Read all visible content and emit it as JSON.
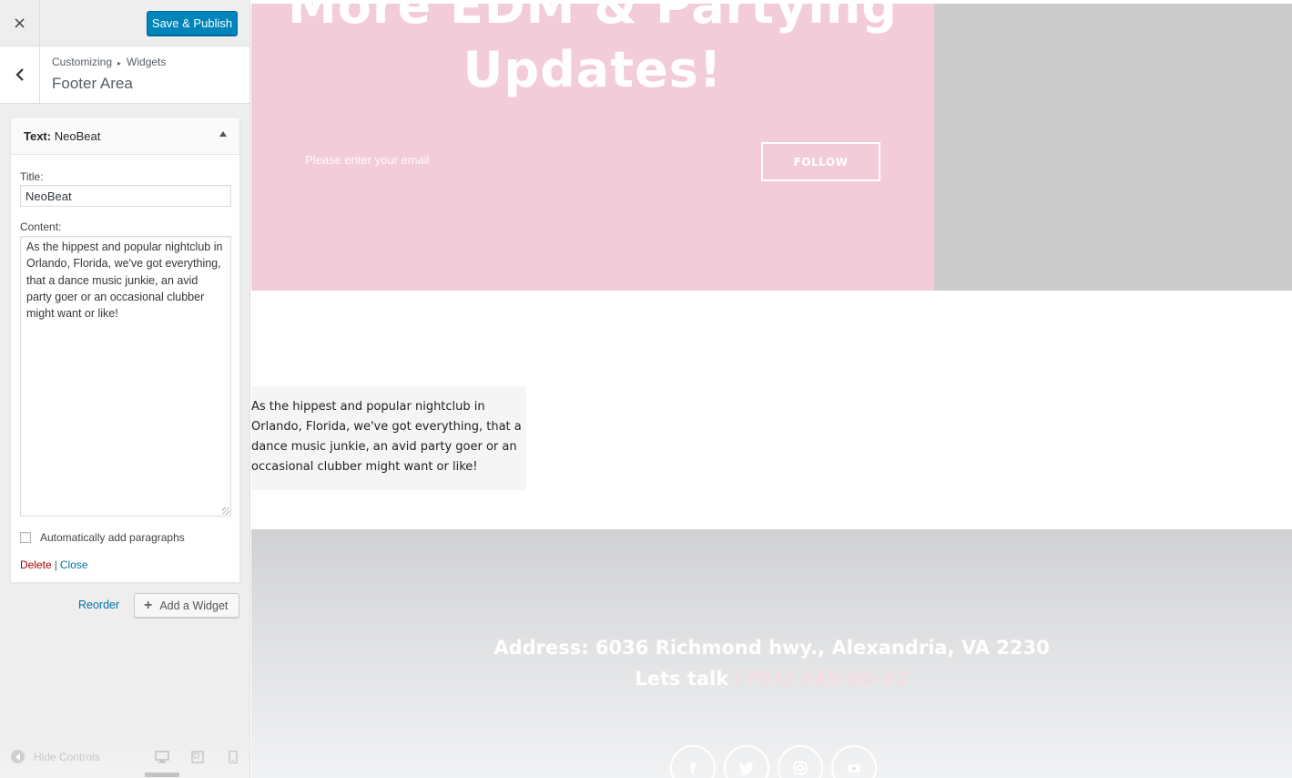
{
  "toolbar": {
    "close_icon": "×",
    "publish_label": "Save & Publish"
  },
  "section": {
    "breadcrumb": [
      "Customizing",
      "Widgets"
    ],
    "title": "Footer Area"
  },
  "widget": {
    "type_label": "Text:",
    "name": "NeoBeat",
    "title_label": "Title:",
    "title_value": "NeoBeat",
    "content_label": "Content:",
    "content_value": "As the hippest and popular nightclub in Orlando, Florida, we've got everything, that a dance music junkie, an avid party goer or an occasional clubber might want or like!",
    "autop_label": "Automatically add paragraphs",
    "delete_label": "Delete",
    "pipe": "|",
    "close_label": "Close"
  },
  "controls": {
    "reorder_label": "Reorder",
    "add_widget_label": "Add a Widget",
    "hide_controls_label": "Hide Controls"
  },
  "preview": {
    "hero_title": "More EDM & Partying Updates!",
    "email_placeholder": "Please enter your email",
    "follow_label": "FOLLOW",
    "widget_text": "As the hippest and popular nightclub in Orlando, Florida, we've got everything, that a dance music junkie, an avid party goer or an occasional clubber might want or like!",
    "address": "Address: 6036 Richmond hwy., Alexandria, VA 2230",
    "contact_prefix": "Lets talk",
    "phone": "(703) 329-06-32",
    "social_icons": [
      "facebook-icon",
      "twitter-icon",
      "instagram-icon",
      "youtube-icon"
    ]
  },
  "colors": {
    "publish_blue": "#0085ba",
    "hero_pink": "#f3ccd9",
    "link_blue": "#0073aa",
    "delete_red": "#aa0000"
  }
}
